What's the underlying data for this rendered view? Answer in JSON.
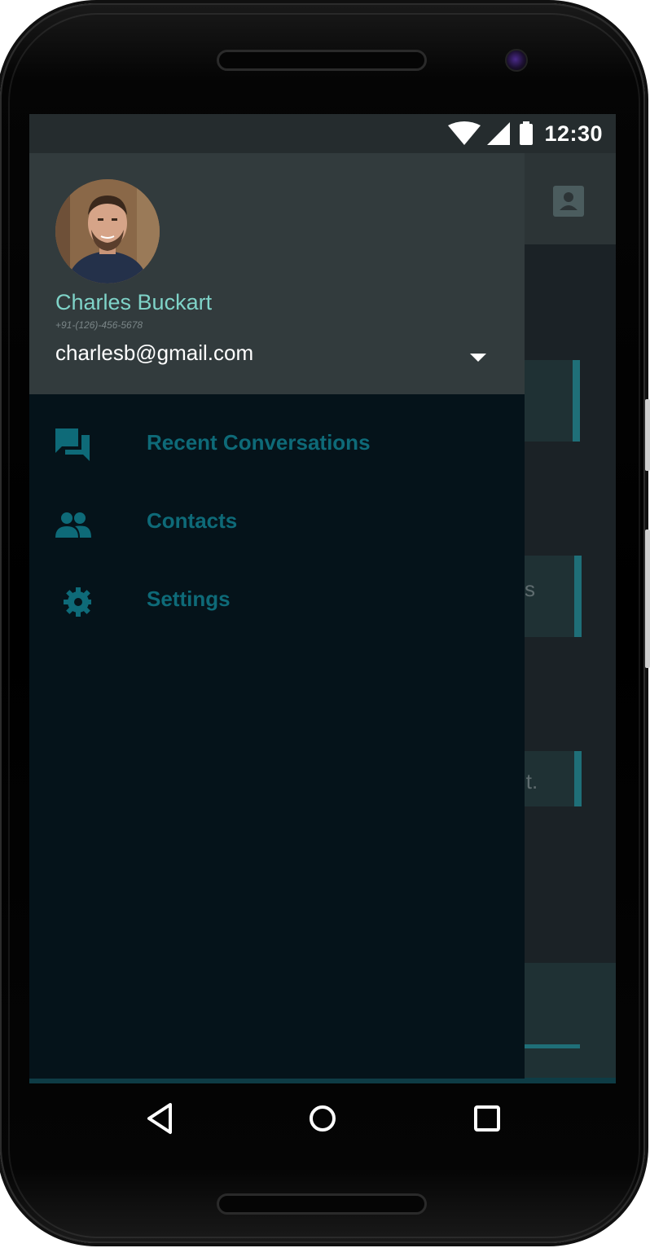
{
  "status_bar": {
    "time": "12:30",
    "icons": [
      "wifi-icon",
      "signal-icon",
      "battery-icon"
    ]
  },
  "background_app": {
    "card_texts": [
      "s",
      "it."
    ]
  },
  "drawer": {
    "user": {
      "name": "Charles Buckart",
      "phone": "+91-(126)-456-5678",
      "email": "charlesb@gmail.com"
    },
    "items": [
      {
        "label": "Recent Conversations",
        "icon": "forum-icon"
      },
      {
        "label": "Contacts",
        "icon": "people-icon"
      },
      {
        "label": "Settings",
        "icon": "gear-icon"
      }
    ]
  },
  "nav_bar": {
    "buttons": [
      "back-icon",
      "home-icon",
      "recents-icon"
    ]
  },
  "colors": {
    "accent": "#7fd3c8",
    "menu_text": "#0e6a78",
    "drawer_bg": "#05131a",
    "header_bg": "#323b3d"
  }
}
